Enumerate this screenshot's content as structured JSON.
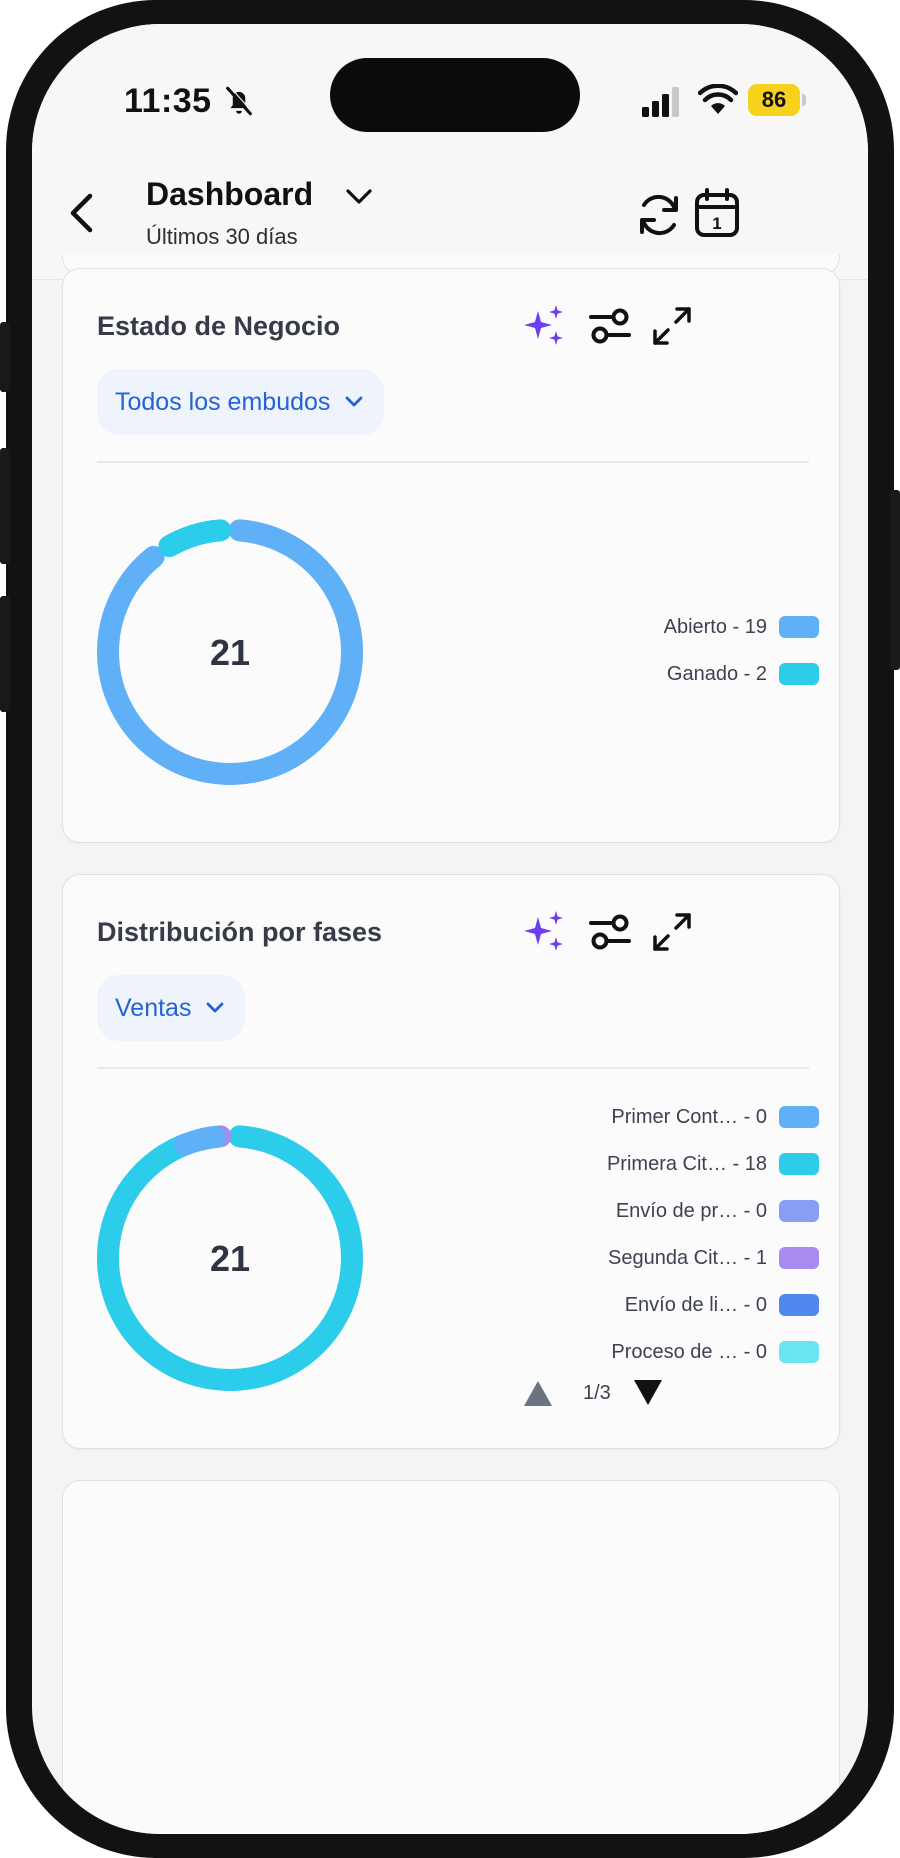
{
  "status": {
    "time": "11:35",
    "battery": "86"
  },
  "header": {
    "title": "Dashboard",
    "subtitle": "Últimos 30 días"
  },
  "icons": {
    "back": "chevron-left-icon",
    "title_toggle": "chevron-down-icon",
    "refresh": "refresh-icon",
    "calendar": "calendar-icon",
    "calendar_day": "1",
    "sparkle": "sparkle-icon",
    "filter": "sliders-icon",
    "expand": "expand-icon"
  },
  "cards": [
    {
      "title": "Estado de Negocio",
      "filter_label": "Todos los embudos",
      "total": "21",
      "legend": [
        {
          "label": "Abierto - 19",
          "value": 19,
          "color": "#60b0f8"
        },
        {
          "label": "Ganado - 2",
          "value": 2,
          "color": "#2ccdea"
        }
      ]
    },
    {
      "title": "Distribución por fases",
      "filter_label": "Ventas",
      "total": "21",
      "legend": [
        {
          "label": "Primer Cont… - 0",
          "value": 0,
          "color": "#60b0f8"
        },
        {
          "label": "Primera Cit… - 18",
          "value": 18,
          "color": "#2ccdea"
        },
        {
          "label": "Envío de pr… - 0",
          "value": 0,
          "color": "#8a9df4"
        },
        {
          "label": "Segunda Cit… - 1",
          "value": 1,
          "color": "#a88bf0"
        },
        {
          "label": "Envío de li… - 0",
          "value": 0,
          "color": "#5288ee"
        },
        {
          "label": "Proceso de … - 0",
          "value": 0,
          "color": "#6be4f2"
        }
      ],
      "pager": "1/3"
    }
  ],
  "chart_data": [
    {
      "type": "pie",
      "categories": [
        "Abierto",
        "Ganado"
      ],
      "values": [
        19,
        2
      ],
      "colors": [
        "#60b0f8",
        "#2ccdea"
      ],
      "center_label": "21"
    },
    {
      "type": "pie",
      "categories": [
        "Primer Cont…",
        "Primera Cit…",
        "Envío de pr…",
        "Segunda Cit…",
        "Envío de li…",
        "Proceso de …"
      ],
      "values": [
        0,
        18,
        0,
        1,
        0,
        0
      ],
      "colors": [
        "#60b0f8",
        "#2ccdea",
        "#8a9df4",
        "#a88bf0",
        "#5288ee",
        "#6be4f2"
      ],
      "center_label": "21",
      "note_visible_arc_colors": [
        "#2ccdea",
        "#a88bf0",
        "#60b0f8"
      ]
    }
  ]
}
